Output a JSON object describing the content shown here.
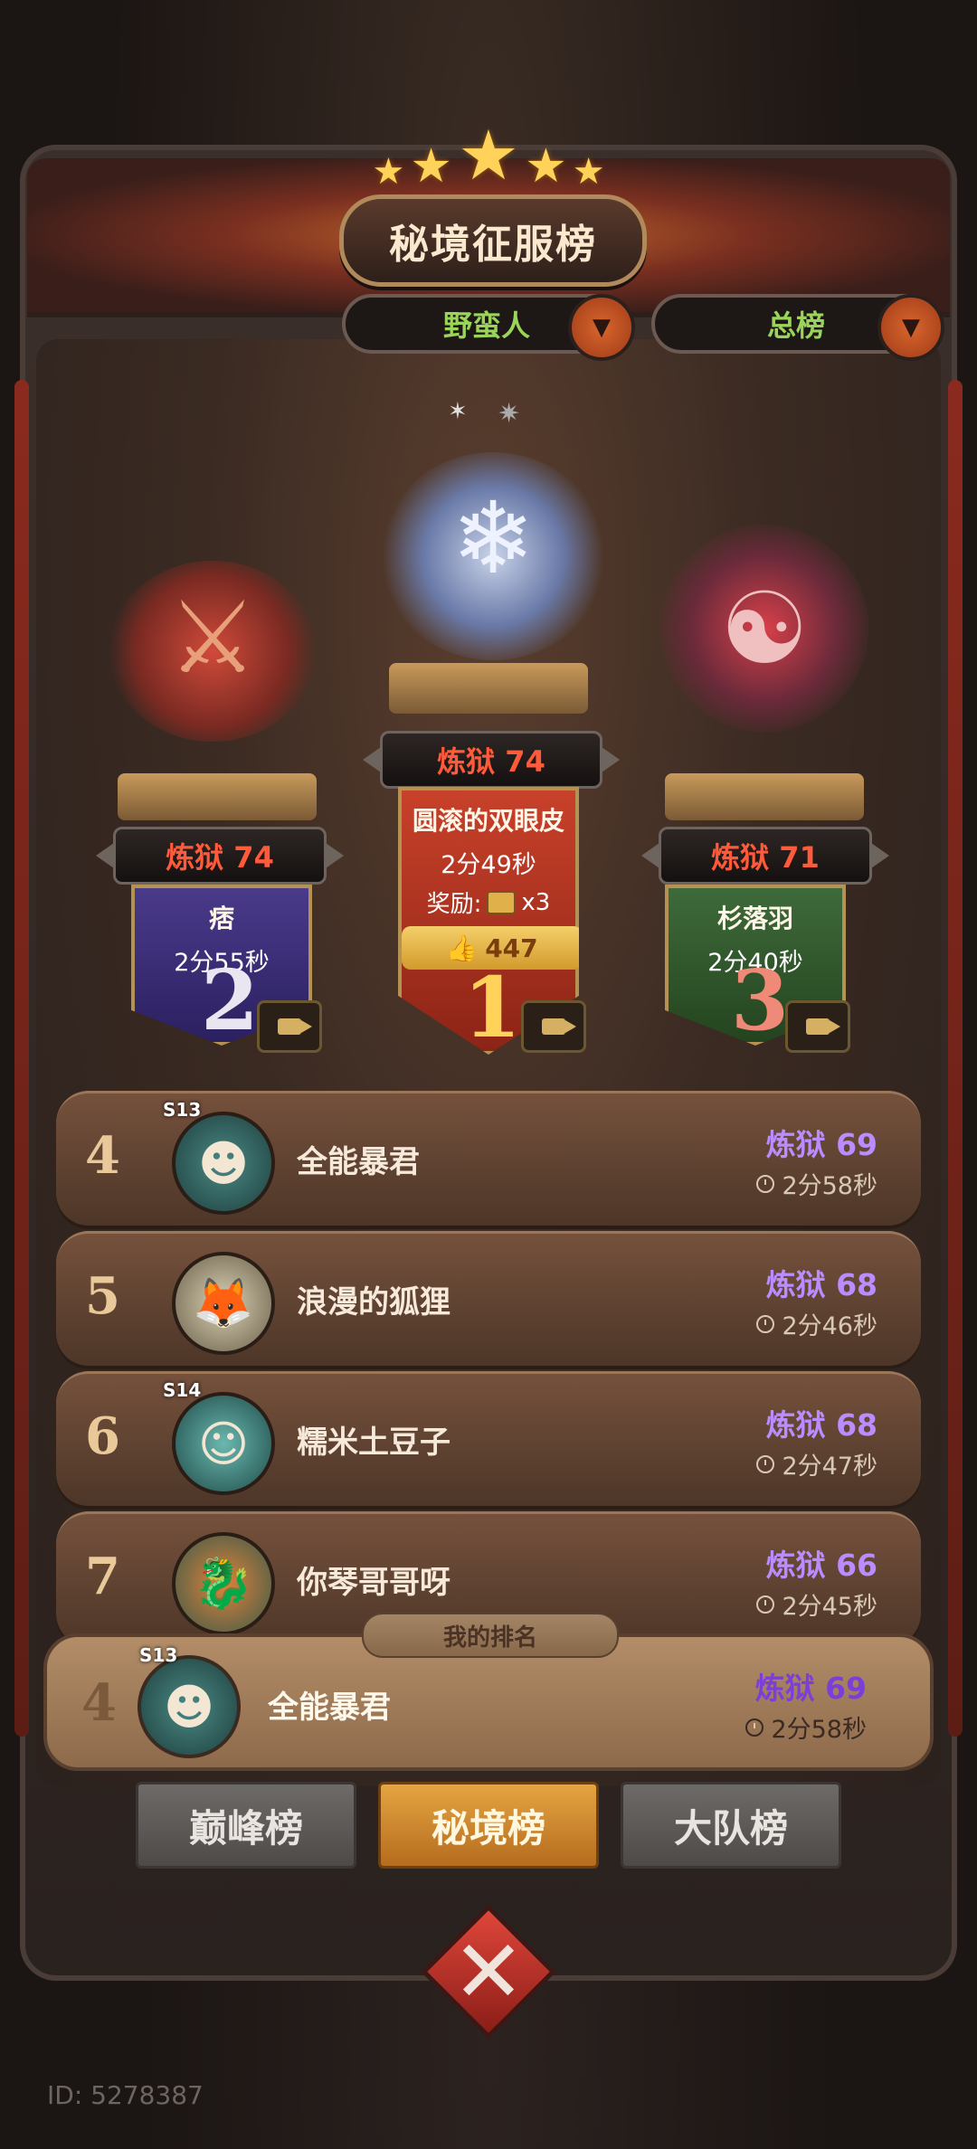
{
  "header": {
    "title": "秘境征服榜",
    "filters": [
      {
        "label": "野蛮人"
      },
      {
        "label": "总榜"
      }
    ]
  },
  "podium": {
    "first": {
      "rank": "1",
      "tier": "炼狱 74",
      "name": "圆滚的双眼皮",
      "time": "2分49秒",
      "reward_label": "奖励:",
      "reward_count": "x3",
      "likes": "447"
    },
    "second": {
      "rank": "2",
      "tier": "炼狱 74",
      "name": "痞",
      "time": "2分55秒"
    },
    "third": {
      "rank": "3",
      "tier": "炼狱 71",
      "name": "杉落羽",
      "time": "2分40秒"
    }
  },
  "list": [
    {
      "pos": "4",
      "season": "S13",
      "name": "全能暴君",
      "tier": "炼狱 69",
      "time": "2分58秒"
    },
    {
      "pos": "5",
      "season": "",
      "name": "浪漫的狐狸",
      "tier": "炼狱 68",
      "time": "2分46秒"
    },
    {
      "pos": "6",
      "season": "S14",
      "name": "糯米土豆子",
      "tier": "炼狱 68",
      "time": "2分47秒"
    },
    {
      "pos": "7",
      "season": "",
      "name": "你琴哥哥呀",
      "tier": "炼狱 66",
      "time": "2分45秒"
    }
  ],
  "my_rank": {
    "tag": "我的排名",
    "pos": "4",
    "season": "S13",
    "name": "全能暴君",
    "tier": "炼狱 69",
    "time": "2分58秒"
  },
  "tabs": [
    {
      "label": "巅峰榜",
      "active": false
    },
    {
      "label": "秘境榜",
      "active": true
    },
    {
      "label": "大队榜",
      "active": false
    }
  ],
  "footer": {
    "uid": "ID: 5278387"
  },
  "colors": {
    "tier_red": "#ff5a3a",
    "tier_purple": "#b98cff",
    "filter_green": "#9ad45a",
    "gold": "#ffd35a"
  },
  "icons": [
    "star-icon",
    "dropdown-icon",
    "video-icon",
    "chest-icon",
    "thumbs-up-icon",
    "clock-icon",
    "close-icon"
  ]
}
